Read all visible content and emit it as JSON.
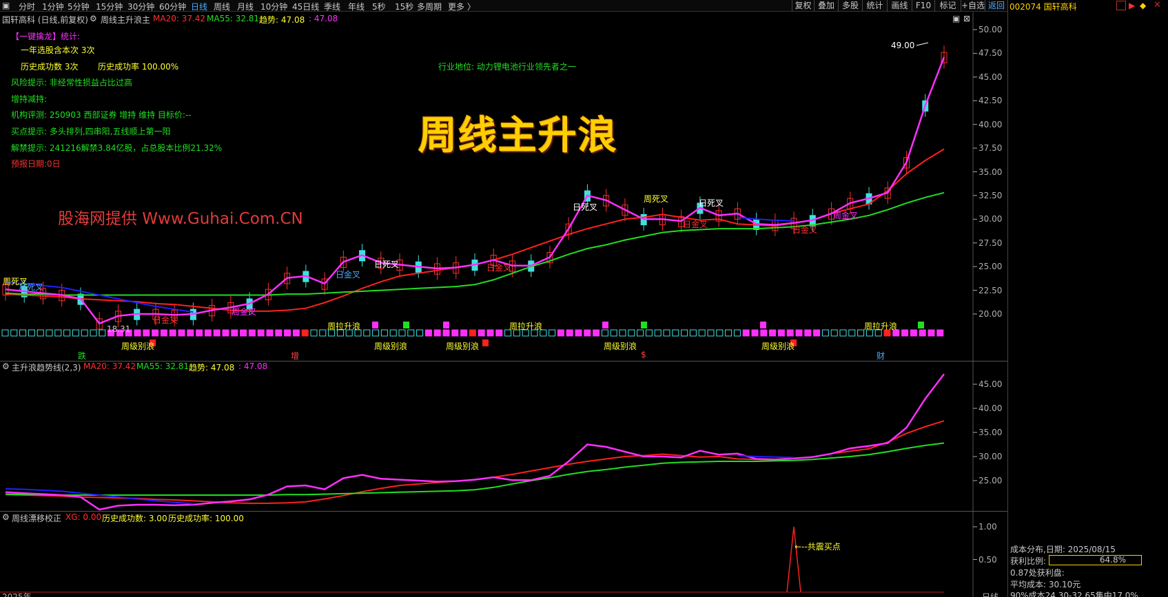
{
  "toolbar": {
    "periods": [
      "分时",
      "1分钟",
      "5分钟",
      "15分钟",
      "30分钟",
      "60分钟",
      "日线",
      "周线",
      "月线",
      "10分钟",
      "45日线",
      "季线",
      "年线",
      "5秒",
      "15秒",
      "多周期",
      "更多 〉"
    ],
    "active_period": "日线",
    "right_buttons": [
      "复权",
      "叠加",
      "多股",
      "统计",
      "画线",
      "F10",
      "标记",
      "+自选",
      "返回"
    ]
  },
  "stock": {
    "code_name": "002074 国轩高科"
  },
  "main_panel": {
    "stock_label": "国轩高科 (日线,前复权)",
    "indicator_name": "周线主升浪主",
    "ma20": "MA20: 37.42",
    "ma55": "MA55: 32.81",
    "trend_label": "趋势: 47.08",
    "trend_value": ": 47.08",
    "big_title": "周线主升浪",
    "watermark": "股海网提供 Www.Guhai.Com.CN",
    "industry": "行业地位: 动力锂电池行业领先者之一",
    "stats": {
      "header": "【一键擒龙】统计:",
      "yearly_hits": "一年选股含本次 3次",
      "hist_success": "历史成功数 3次",
      "hist_rate": "历史成功率 100.00%",
      "risk": "风险提示: 非经常性损益占比过高",
      "holding": "增持减持:",
      "inst_rating": "机构评测: 250903 西部证券 增持 维持 目标价:--",
      "buy_tip": "买点提示: 多头排列,四串阳,五线顺上第一阳",
      "unlock": "解禁提示: 241216解禁3.84亿股，占总股本比例21.32%",
      "forecast": "预报日期:0日"
    },
    "annotations": {
      "week_dead_1": "周死叉",
      "month_dead": "月死叉",
      "low_price": "18.31",
      "day_golden_1": "日金叉",
      "week_golden_1": "周金叉",
      "day_golden_2": "日金叉",
      "day_dead_1": "日死叉",
      "day_golden_3": "日金叉",
      "day_dead_2": "日死叉",
      "week_dead_2": "周死叉",
      "day_dead_3": "日死叉",
      "day_golden_4": "日金叉",
      "week_golden_2": "周金叉",
      "day_golden_5": "日金叉",
      "high_price": "49.00",
      "wave_1": "周拉升浪",
      "wave_2": "周拉升浪",
      "wave_3": "周拉升浪",
      "bye_1": "周级别浪",
      "bye_2": "周级别浪",
      "bye_3": "周级别浪",
      "bye_4": "周级别浪",
      "bye_5": "周级别浪",
      "mark_die": "跌",
      "mark_zeng": "增",
      "mark_s": "$",
      "mark_cai": "财"
    },
    "y_ticks": [
      "50.00",
      "47.50",
      "45.00",
      "42.50",
      "40.00",
      "37.50",
      "35.00",
      "32.50",
      "30.00",
      "27.50",
      "25.00",
      "22.50",
      "20.00"
    ]
  },
  "panel2": {
    "name": "主升浪趋势线(2,3)",
    "ma20": "MA20: 37.42",
    "ma55": "MA55: 32.81",
    "trend_label": "趋势: 47.08",
    "trend_value": ": 47.08",
    "y_ticks": [
      "45.00",
      "40.00",
      "35.00",
      "30.00",
      "25.00"
    ]
  },
  "panel3": {
    "name": "周线漂移校正",
    "xg": "XG: 0.00",
    "success_count": "历史成功数: 3.00",
    "success_rate": "历史成功率: 100.00",
    "signal_label": "←--共震买点",
    "y_ticks": [
      "1.00",
      "0.50"
    ]
  },
  "bottom_axis": {
    "first_label": "2025年",
    "right_label": "日线"
  },
  "cost_distribution": {
    "date_line": "成本分布,日期: 2025/08/15",
    "profit_ratio_label": "获利比例:",
    "profit_ratio": "64.8%",
    "profit_ratio_value": 0.648,
    "profit_disk": "0.87处获利盘:",
    "avg_cost": "平均成本: 30.10元",
    "concentration": "90%成本24.30-32.65集中17.0%"
  },
  "chart_data": {
    "type": "line",
    "ylim": [
      17.5,
      51.2
    ],
    "y_ticks": [
      50,
      47.5,
      45,
      42.5,
      40,
      37.5,
      35,
      32.5,
      30,
      27.5,
      25,
      22.5,
      20
    ],
    "series": [
      {
        "name": "MA20",
        "color": "#ff2020",
        "values": [
          22.1,
          22.0,
          21.9,
          21.8,
          21.6,
          21.5,
          21.4,
          21.3,
          21.1,
          21.0,
          20.8,
          20.6,
          20.4,
          20.3,
          20.3,
          20.4,
          20.6,
          21.2,
          21.9,
          22.7,
          23.4,
          24.0,
          24.3,
          24.6,
          24.9,
          25.2,
          25.7,
          26.3,
          27.0,
          27.7,
          28.4,
          29.0,
          29.5,
          30.0,
          30.2,
          30.5,
          30.2,
          29.9,
          30.0,
          29.5,
          29.4,
          29.3,
          29.6,
          29.9,
          30.6,
          31.1,
          31.6,
          33.0,
          34.8,
          36.2,
          37.4
        ]
      },
      {
        "name": "MA55",
        "color": "#20e020",
        "values": [
          22.2,
          22.1,
          22.1,
          22.0,
          22.0,
          22.0,
          22.0,
          22.0,
          22.0,
          22.0,
          22.0,
          22.0,
          22.0,
          22.0,
          22.0,
          22.1,
          22.1,
          22.2,
          22.3,
          22.4,
          22.5,
          22.6,
          22.7,
          22.8,
          22.9,
          23.1,
          23.6,
          24.3,
          25.0,
          25.6,
          26.3,
          26.9,
          27.3,
          27.8,
          28.2,
          28.6,
          28.8,
          28.9,
          29.0,
          29.0,
          29.0,
          29.1,
          29.2,
          29.4,
          29.7,
          30.0,
          30.4,
          31.0,
          31.7,
          32.3,
          32.8
        ]
      },
      {
        "name": "趋势",
        "color": "#ff30ff",
        "values": [
          22.6,
          22.4,
          22.2,
          22.0,
          21.6,
          19.0,
          19.8,
          20.0,
          20.0,
          19.9,
          20.0,
          20.4,
          20.7,
          21.1,
          22.1,
          23.8,
          24.0,
          23.2,
          25.5,
          26.2,
          25.4,
          25.2,
          25.0,
          24.8,
          24.9,
          25.2,
          25.7,
          25.1,
          25.1,
          26.0,
          29.0,
          32.5,
          32.0,
          31.0,
          30.0,
          30.0,
          29.8,
          31.2,
          30.4,
          30.6,
          29.5,
          29.4,
          29.6,
          29.9,
          30.6,
          31.7,
          32.2,
          32.8,
          36.0,
          42.0,
          47.1
        ]
      },
      {
        "name": "month_line",
        "color": "#2020ff",
        "values": [
          23.3,
          23.2,
          23.0,
          22.8,
          22.4,
          22.0,
          21.6,
          21.2,
          20.8,
          20.5,
          20.2,
          null,
          null,
          null,
          null,
          null,
          null,
          null,
          null,
          null,
          null,
          null,
          null,
          null,
          null,
          null,
          null,
          null,
          null,
          null,
          null,
          null,
          null,
          null,
          null,
          null,
          null,
          null,
          null,
          30.2,
          30.0,
          29.9,
          29.8,
          null,
          null,
          null,
          null,
          null,
          null,
          null,
          null
        ]
      }
    ],
    "x_count": 51,
    "indicator_signal": {
      "x_index": 40,
      "value": 1.0
    }
  }
}
